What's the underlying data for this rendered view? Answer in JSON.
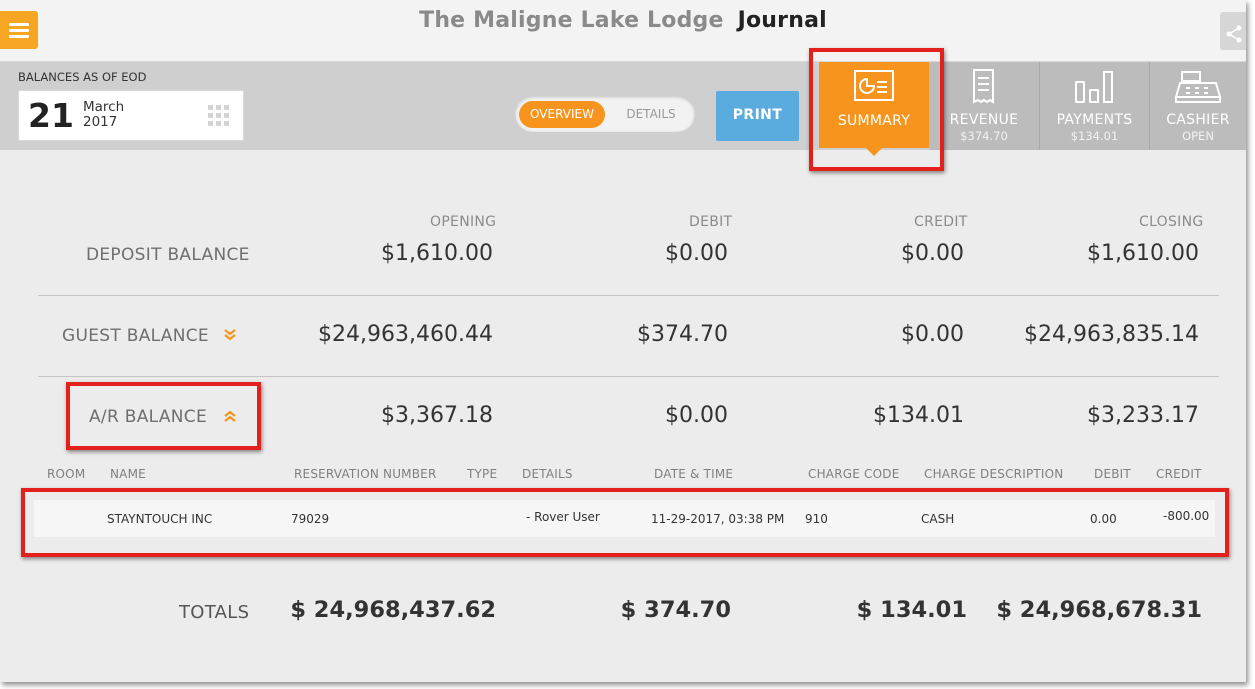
{
  "header": {
    "hotel_name": "The Maligne Lake Lodge",
    "page_title": "Journal"
  },
  "toolbar": {
    "eod_label": "BALANCES AS OF EOD",
    "date": {
      "day": "21",
      "month": "March",
      "year": "2017"
    },
    "view_toggle": {
      "options": [
        "OVERVIEW",
        "DETAILS"
      ],
      "selected": "OVERVIEW"
    },
    "print_label": "PRINT",
    "tabs": {
      "summary": {
        "label": "SUMMARY",
        "sub": ""
      },
      "revenue": {
        "label": "REVENUE",
        "sub": "$374.70"
      },
      "payments": {
        "label": "PAYMENTS",
        "sub": "$134.01"
      },
      "cashier": {
        "label": "CASHIER",
        "sub": "OPEN"
      }
    }
  },
  "summary_table": {
    "columns": {
      "opening": "OPENING",
      "debit": "DEBIT",
      "credit": "CREDIT",
      "closing": "CLOSING"
    },
    "rows": {
      "deposit": {
        "label": "DEPOSIT BALANCE",
        "opening": "$1,610.00",
        "debit": "$0.00",
        "credit": "$0.00",
        "closing": "$1,610.00"
      },
      "guest": {
        "label": "GUEST BALANCE",
        "opening": "$24,963,460.44",
        "debit": "$374.70",
        "credit": "$0.00",
        "closing": "$24,963,835.14"
      },
      "ar": {
        "label": "A/R BALANCE",
        "opening": "$3,367.18",
        "debit": "$0.00",
        "credit": "$134.01",
        "closing": "$3,233.17"
      }
    }
  },
  "ar_details": {
    "columns": {
      "room": "ROOM",
      "name": "NAME",
      "reservation": "RESERVATION NUMBER",
      "type": "TYPE",
      "details": "DETAILS",
      "datetime": "DATE & TIME",
      "charge_code": "CHARGE CODE",
      "charge_description": "CHARGE DESCRIPTION",
      "debit": "DEBIT",
      "credit": "CREDIT"
    },
    "rows": [
      {
        "room": "",
        "name": "STAYNTOUCH INC",
        "reservation": "79029",
        "type": "",
        "details": "- Rover User",
        "datetime": "11-29-2017, 03:38 PM",
        "charge_code": "910",
        "charge_description": "CASH",
        "debit": "0.00",
        "credit": "-800.00"
      }
    ]
  },
  "totals": {
    "label": "TOTALS",
    "opening": "$ 24,968,437.62",
    "debit": "$ 374.70",
    "credit": "$ 134.01",
    "closing": "$ 24,968,678.31"
  },
  "colors": {
    "accent": "#f7941d",
    "print": "#5aacdf",
    "annotation": "#e3201b"
  },
  "icons": [
    "menu-icon",
    "share-icon",
    "calendar-grid-icon",
    "summary-icon",
    "revenue-receipt-icon",
    "payments-chart-icon",
    "cashier-register-icon",
    "chevron-double-down-icon",
    "chevron-double-up-icon"
  ]
}
